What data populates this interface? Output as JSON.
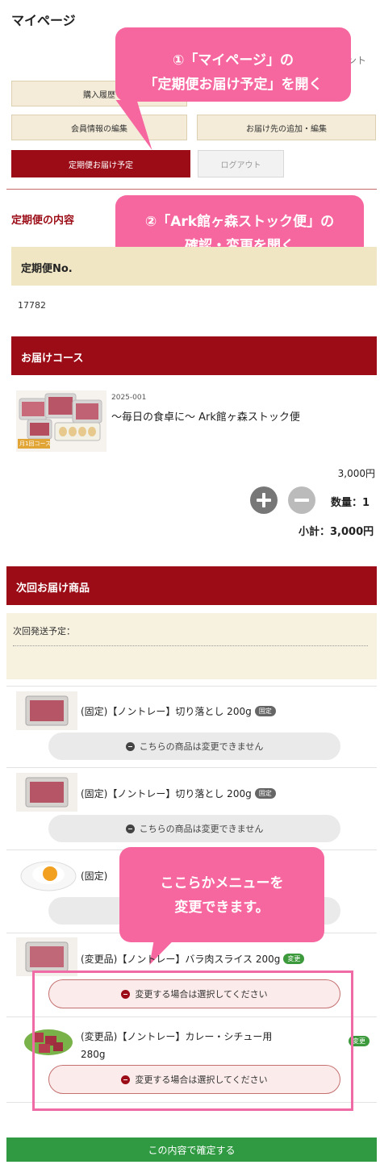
{
  "header": {
    "title": "マイページ",
    "top_right_fragment": "ント"
  },
  "menu": {
    "purchase_history": "購入履歴",
    "member_info_edit": "会員情報の編集",
    "delivery_address": "お届け先の追加・編集",
    "subscription_schedule": "定期便お届け予定",
    "logout": "ログアウト"
  },
  "callouts": {
    "step1_line1": "①「マイページ」の",
    "step1_line2": "「定期便お届け予定」を開く",
    "step2_line1": "②「Ark館ヶ森ストック便」の",
    "step2_line2": "確認・変更を開く",
    "step3_line1": "ここらかメニューを",
    "step3_line2": "変更できます。"
  },
  "subscription": {
    "section_title": "定期便の内容",
    "number_label": "定期便No.",
    "number_value": "17782"
  },
  "course": {
    "section_title": "お届けコース",
    "thumb_badge": "月1回コース",
    "code": "2025-001",
    "name": "〜毎日の食卓に〜 Ark館ヶ森ストック便",
    "price": "3,000円",
    "quantity_label": "数量：1",
    "subtotal": "小計：3,000円"
  },
  "next_delivery": {
    "section_title": "次回お届け商品",
    "ship_label": "次回発送予定：",
    "items": [
      {
        "text": "(固定)【ノントレー】切り落とし 200g",
        "badge": "固定",
        "button": "こちらの商品は変更できません"
      },
      {
        "text": "(固定)【ノントレー】切り落とし 200g",
        "badge": "固定",
        "button": "こちらの商品は変更できません"
      },
      {
        "text": "(固定)",
        "badge": "",
        "button": ""
      },
      {
        "text": "(変更品)【ノントレー】バラ肉スライス 200g",
        "badge": "変更",
        "button": "変更する場合は選択してください"
      },
      {
        "text": "(変更品)【ノントレー】カレー・シチュー用",
        "text2": "280g",
        "badge": "変更",
        "button": "変更する場合は選択してください"
      }
    ]
  },
  "confirm_button": "この内容で確定する",
  "colors": {
    "brand_red": "#9b0c16",
    "callout_pink": "#f6679f",
    "confirm_green": "#2f9a42",
    "tan": "#f1e6c4"
  }
}
